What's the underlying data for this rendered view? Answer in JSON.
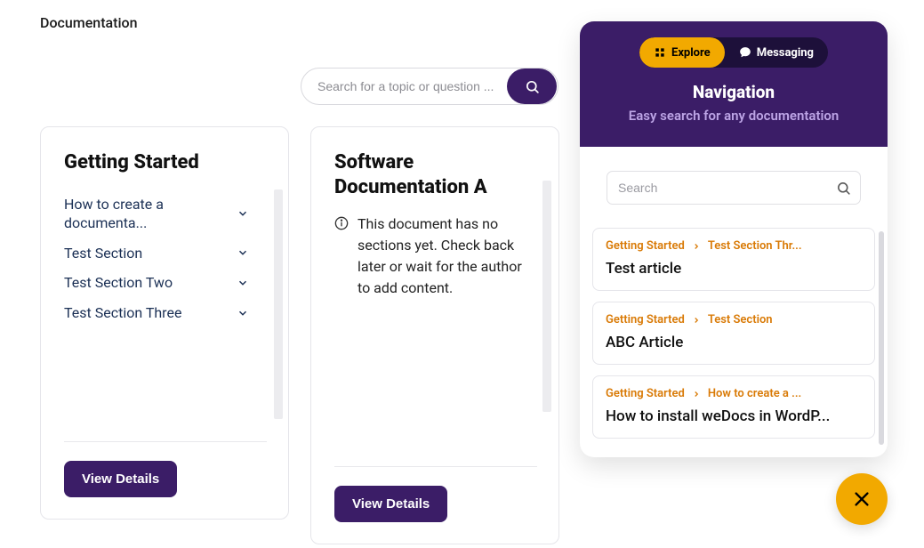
{
  "page": {
    "title": "Documentation"
  },
  "search": {
    "placeholder": "Search for a topic or question ..."
  },
  "cards": [
    {
      "title": "Getting Started",
      "sections": [
        "How to create a documenta...",
        "Test Section",
        "Test Section Two",
        "Test Section Three"
      ],
      "button": "View Details"
    },
    {
      "title": "Software Documentation A",
      "empty_message": "This document has no sections yet. Check back later or wait for the author to add content.",
      "button": "View Details"
    }
  ],
  "widget": {
    "tabs": {
      "explore": "Explore",
      "messaging": "Messaging"
    },
    "title": "Navigation",
    "subtitle": "Easy search for any documentation",
    "search_placeholder": "Search",
    "results": [
      {
        "crumb1": "Getting Started",
        "crumb2": "Test Section Thr...",
        "title": "Test article"
      },
      {
        "crumb1": "Getting Started",
        "crumb2": "Test Section",
        "title": "ABC Article"
      },
      {
        "crumb1": "Getting Started",
        "crumb2": "How to create a ...",
        "title": "How to install weDocs in WordP..."
      }
    ]
  }
}
